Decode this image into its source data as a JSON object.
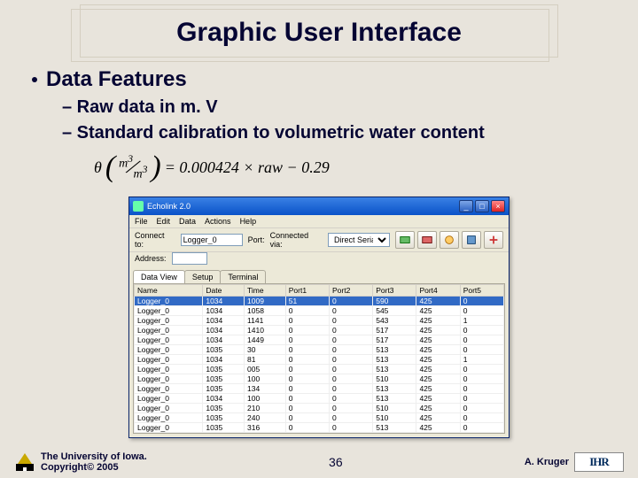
{
  "title": "Graphic User Interface",
  "bullets": {
    "main": "Data Features",
    "sub1": "– Raw data in m. V",
    "sub2": "– Standard calibration to volumetric water content"
  },
  "formula": {
    "theta": "θ",
    "unit_num": "m",
    "unit_sup": "3",
    "unit_den": "m",
    "unit_den_sup": "3",
    "expr": "= 0.000424 × raw − 0.29"
  },
  "window": {
    "title": "Echolink 2.0",
    "menu": [
      "File",
      "Edit",
      "Data",
      "Actions",
      "Help"
    ],
    "connect_label": "Connect to:",
    "connect_value": "Logger_0",
    "port_label": "Port:",
    "port_value": "Connected via:",
    "port_sel": "Direct Serial",
    "address_label": "Address:",
    "tabs": [
      "Data View",
      "Setup",
      "Terminal"
    ],
    "columns": [
      "Name",
      "Date",
      "Time",
      "Port1",
      "Port2",
      "Port3",
      "Port4",
      "Port5"
    ],
    "rows": [
      [
        "Logger_0",
        "1034",
        "1009",
        "51",
        "0",
        "590",
        "425",
        "0"
      ],
      [
        "Logger_0",
        "1034",
        "1058",
        "0",
        "0",
        "545",
        "425",
        "0"
      ],
      [
        "Logger_0",
        "1034",
        "1141",
        "0",
        "0",
        "543",
        "425",
        "1"
      ],
      [
        "Logger_0",
        "1034",
        "1410",
        "0",
        "0",
        "517",
        "425",
        "0"
      ],
      [
        "Logger_0",
        "1034",
        "1449",
        "0",
        "0",
        "517",
        "425",
        "0"
      ],
      [
        "Logger_0",
        "1035",
        "30",
        "0",
        "0",
        "513",
        "425",
        "0"
      ],
      [
        "Logger_0",
        "1034",
        "81",
        "0",
        "0",
        "513",
        "425",
        "1"
      ],
      [
        "Logger_0",
        "1035",
        "005",
        "0",
        "0",
        "513",
        "425",
        "0"
      ],
      [
        "Logger_0",
        "1035",
        "100",
        "0",
        "0",
        "510",
        "425",
        "0"
      ],
      [
        "Logger_0",
        "1035",
        "134",
        "0",
        "0",
        "513",
        "425",
        "0"
      ],
      [
        "Logger_0",
        "1034",
        "100",
        "0",
        "0",
        "513",
        "425",
        "0"
      ],
      [
        "Logger_0",
        "1035",
        "210",
        "0",
        "0",
        "510",
        "425",
        "0"
      ],
      [
        "Logger_0",
        "1035",
        "240",
        "0",
        "0",
        "510",
        "425",
        "0"
      ],
      [
        "Logger_0",
        "1035",
        "316",
        "0",
        "0",
        "513",
        "425",
        "0"
      ]
    ]
  },
  "footer": {
    "org1": "The University of Iowa.",
    "org2": "Copyright© 2005",
    "page": "36",
    "author": "A. Kruger",
    "ihr": "IHR"
  }
}
